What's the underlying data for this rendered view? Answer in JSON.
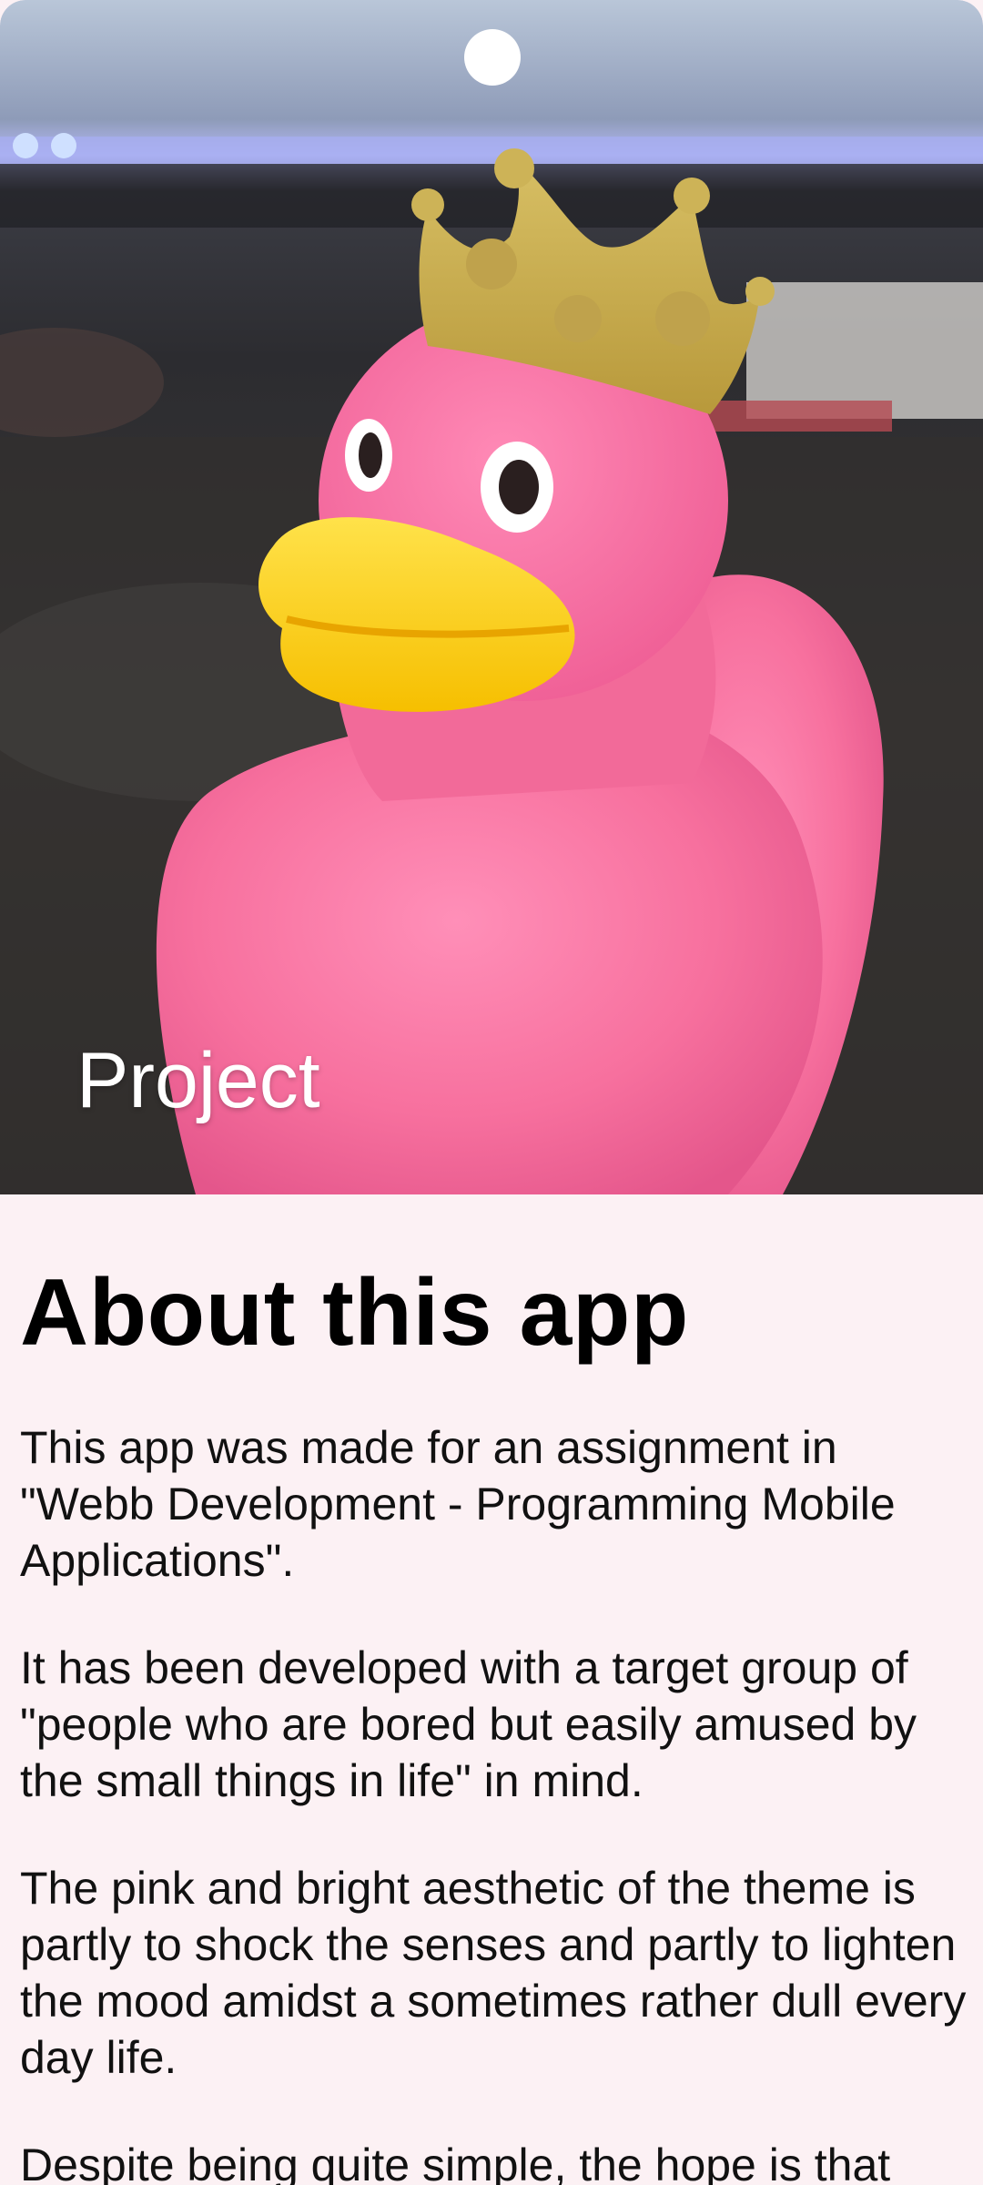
{
  "hero": {
    "image_label": "pink-rubber-duck-with-crown-photo",
    "title": "Project"
  },
  "about": {
    "title": "About this app",
    "paragraphs": [
      "This app was made for an assignment in \"Webb Development - Programming Mobile Applications\".",
      "It has been developed with a target group of \"people who are bored but easily amused by the small things in life\" in mind.",
      "The pink and bright aesthetic of the theme is partly to shock the senses and partly to lighten the mood amidst a sometimes rather dull every day life.",
      "Despite being quite simple, the hope is that"
    ]
  },
  "colors": {
    "background": "#fcf1f4",
    "duck_pink": "#f7709e",
    "beak_yellow": "#ffd21a",
    "crown_gold": "#c9ad4f"
  }
}
